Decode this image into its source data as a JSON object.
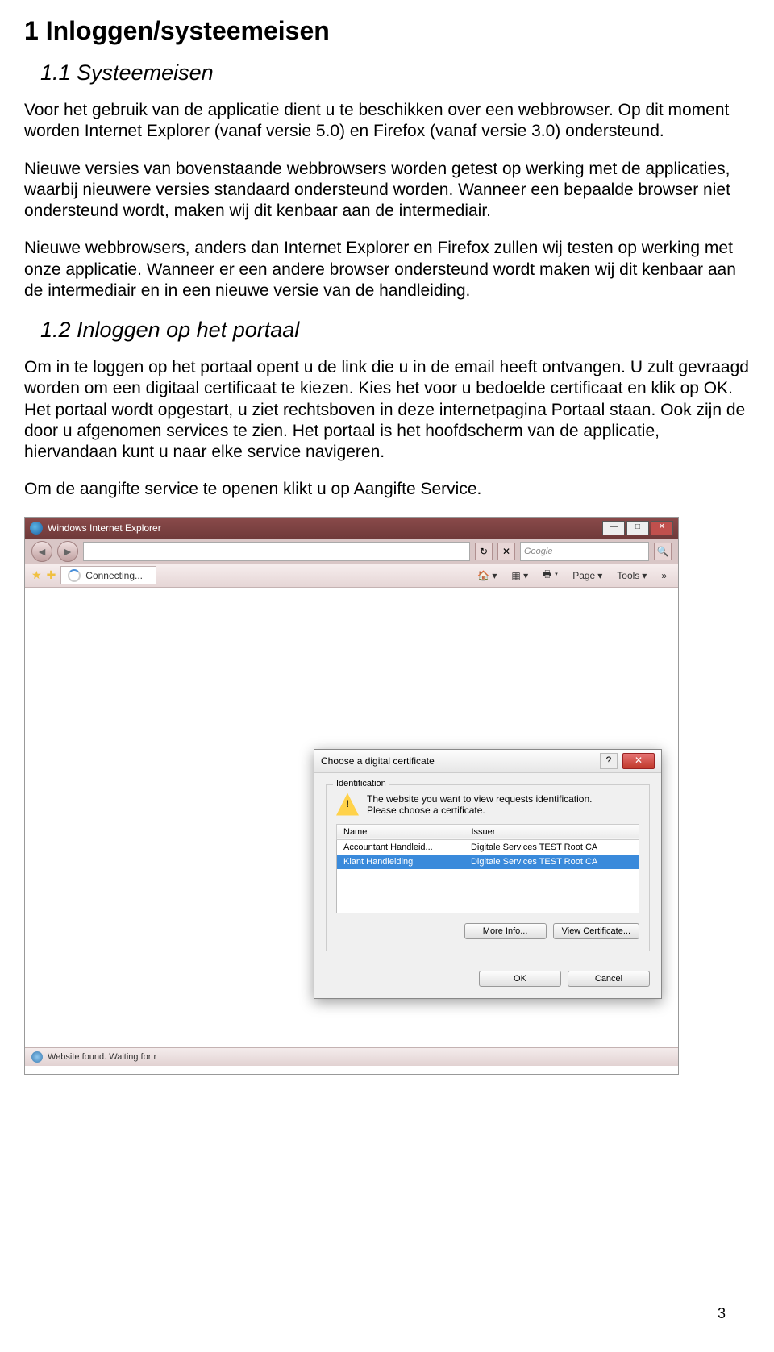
{
  "headings": {
    "h1": "1   Inloggen/systeemeisen",
    "h2a": "1.1  Systeemeisen",
    "h2b": "1.2  Inloggen op het portaal"
  },
  "paragraphs": {
    "p1": "Voor het gebruik van de applicatie dient u te beschikken over een webbrowser. Op dit moment worden Internet Explorer (vanaf versie 5.0) en Firefox (vanaf versie 3.0) ondersteund.",
    "p2": "Nieuwe versies van bovenstaande webbrowsers worden getest op werking met de applicaties, waarbij nieuwere versies standaard ondersteund worden. Wanneer een bepaalde browser niet ondersteund wordt, maken wij dit kenbaar aan de intermediair.",
    "p3": "Nieuwe webbrowsers, anders dan Internet Explorer en Firefox zullen wij testen op werking met onze applicatie. Wanneer er een andere browser ondersteund wordt maken wij dit kenbaar aan de intermediair en in een nieuwe versie van de handleiding.",
    "p4": "Om in te loggen op het portaal opent u de link die u in de email heeft ontvangen. U zult gevraagd worden om een digitaal certificaat te kiezen. Kies het voor u bedoelde certificaat en klik op OK. Het portaal wordt opgestart, u ziet rechtsboven in deze internetpagina Portaal staan. Ook zijn de door u afgenomen services te zien. Het portaal is het hoofdscherm van de applicatie, hiervandaan kunt u naar elke service navigeren.",
    "p5": "Om de aangifte service te openen klikt u op Aangifte Service."
  },
  "ie": {
    "title": "Windows Internet Explorer",
    "search_placeholder": "Google",
    "tab_label": "Connecting...",
    "tool_home": "🏠",
    "tool_page": "Page",
    "tool_tools": "Tools",
    "status": "Website found. Waiting for r"
  },
  "dialog": {
    "title": "Choose a digital certificate",
    "group": "Identification",
    "msg1": "The website you want to view requests identification.",
    "msg2": "Please choose a certificate.",
    "col_name": "Name",
    "col_issuer": "Issuer",
    "rows": [
      {
        "name": "Accountant Handleid...",
        "issuer": "Digitale Services TEST Root CA"
      },
      {
        "name": "Klant Handleiding",
        "issuer": "Digitale Services TEST Root CA"
      }
    ],
    "btn_more": "More Info...",
    "btn_view": "View Certificate...",
    "btn_ok": "OK",
    "btn_cancel": "Cancel"
  },
  "page_number": "3"
}
